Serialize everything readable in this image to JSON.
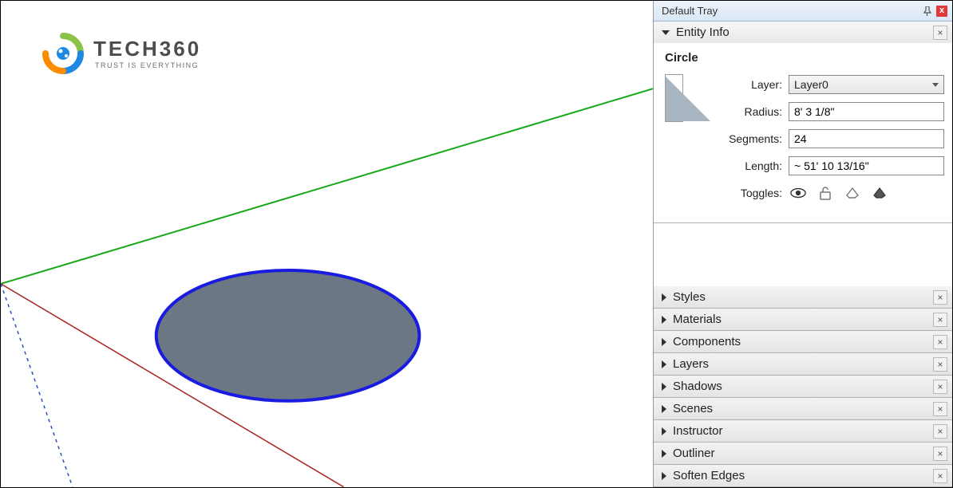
{
  "logo": {
    "title": "TECH360",
    "subtitle": "TRUST IS EVERYTHING"
  },
  "tray": {
    "title": "Default Tray",
    "pin_glyph": "📌",
    "close_glyph": "x"
  },
  "entity_info": {
    "header": "Entity Info",
    "type": "Circle",
    "layer_label": "Layer:",
    "layer_value": "Layer0",
    "radius_label": "Radius:",
    "radius_value": "8' 3 1/8\"",
    "segments_label": "Segments:",
    "segments_value": "24",
    "length_label": "Length:",
    "length_value": "~ 51' 10 13/16\"",
    "toggles_label": "Toggles:"
  },
  "sections": [
    {
      "label": "Styles"
    },
    {
      "label": "Materials"
    },
    {
      "label": "Components"
    },
    {
      "label": "Layers"
    },
    {
      "label": "Shadows"
    },
    {
      "label": "Scenes"
    },
    {
      "label": "Instructor"
    },
    {
      "label": "Outliner"
    },
    {
      "label": "Soften Edges"
    }
  ]
}
